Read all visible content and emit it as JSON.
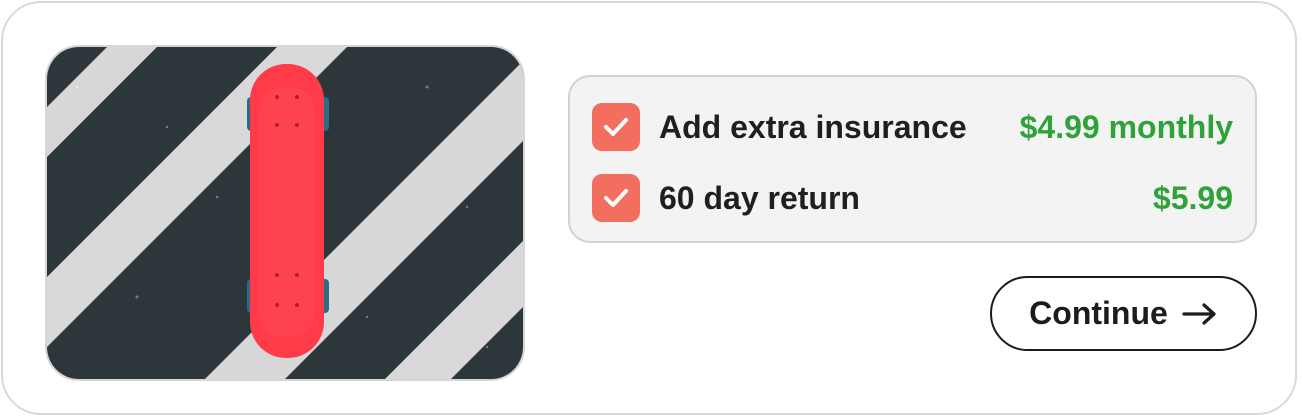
{
  "product": {
    "image_alt": "Red skateboard on striped pavement"
  },
  "options": [
    {
      "label": "Add extra insurance",
      "price": "$4.99 monthly",
      "checked": true
    },
    {
      "label": "60 day return",
      "price": "$5.99",
      "checked": true
    }
  ],
  "actions": {
    "continue_label": "Continue"
  },
  "icons": {
    "checkbox": "check-icon",
    "continue": "arrow-right-icon"
  },
  "colors": {
    "checkbox_fill": "#f26f5f",
    "price_text": "#2fa23a",
    "skateboard": "#ff3b4a"
  }
}
